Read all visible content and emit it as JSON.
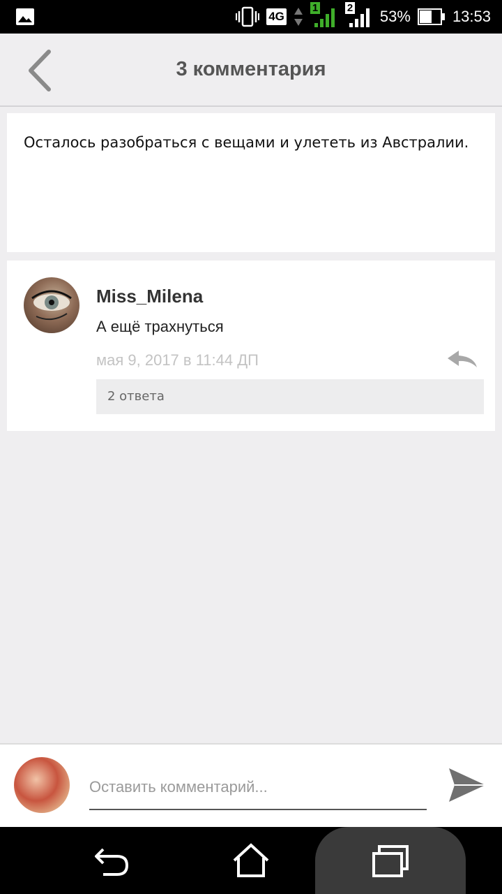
{
  "status_bar": {
    "network": "4G",
    "sim1": "1",
    "sim2": "2",
    "battery": "53%",
    "time": "13:53"
  },
  "header": {
    "title": "3 комментария",
    "back_icon": "chevron-left-icon"
  },
  "post": {
    "text": "Осталось разобраться с вещами и улететь из Австралии."
  },
  "comments": [
    {
      "author": "Miss_Milena",
      "text": "А ещё трахнуться",
      "date": "мая 9, 2017 в 11:44 ДП",
      "replies_label": "2 ответа"
    }
  ],
  "composer": {
    "placeholder": "Оставить комментарий..."
  },
  "colors": {
    "background": "#efeef0",
    "header_title": "#555555",
    "date_text": "#c3c3c3"
  }
}
